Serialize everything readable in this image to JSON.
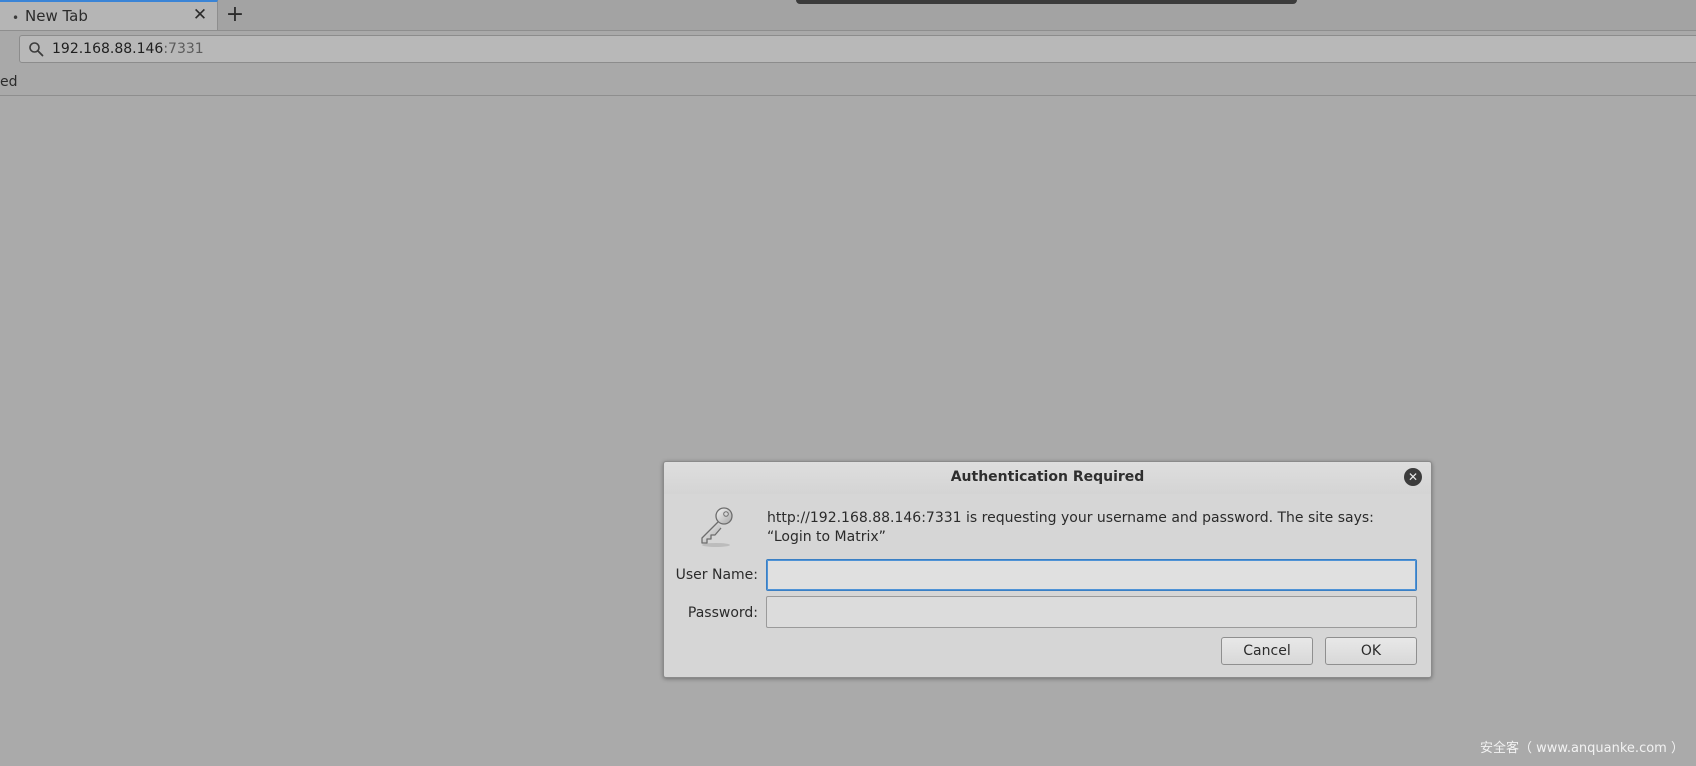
{
  "tabs": [
    {
      "title": "New Tab",
      "active": true
    }
  ],
  "tabstrip": {
    "new_tab_icon": "plus-icon",
    "close_icon": "close-icon",
    "indicator": "•"
  },
  "urlbar": {
    "host": "192.168.88.146",
    "port": ":7331",
    "icon": "search-icon"
  },
  "bookmarks": {
    "partial_item": "ed"
  },
  "dialog": {
    "title": "Authentication Required",
    "message": "http://192.168.88.146:7331 is requesting your username and password. The site says: “Login to Matrix”",
    "username_label": "User Name:",
    "password_label": "Password:",
    "username_value": "",
    "password_value": "",
    "cancel_label": "Cancel",
    "ok_label": "OK",
    "icon": "key-icon"
  },
  "watermark": "安全客（ www.anquanke.com ）",
  "colors": {
    "background": "#aaaaaa",
    "dialog_bg": "#d6d6d6",
    "focus_accent": "#3a7fc4",
    "tab_accent": "#3a84d6"
  }
}
